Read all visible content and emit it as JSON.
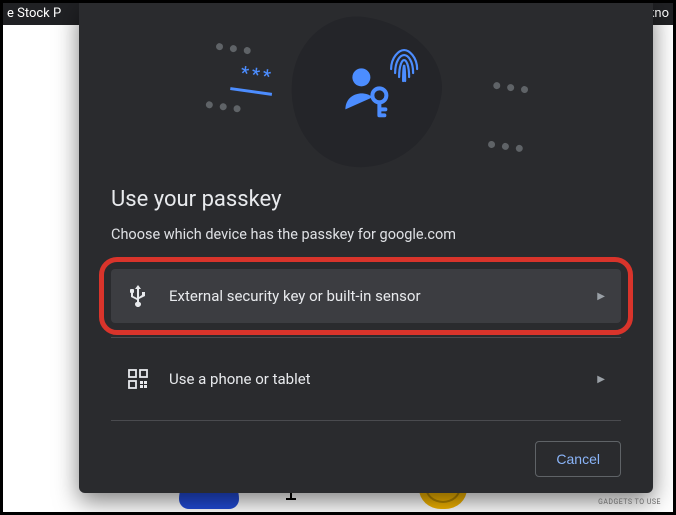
{
  "topbar": {
    "left_text": "e Stock P",
    "right_text": "ate a kno"
  },
  "dialog": {
    "title": "Use your passkey",
    "subtitle": "Choose which device has the passkey for google.com",
    "options": [
      {
        "label": "External security key or built-in sensor"
      },
      {
        "label": "Use a phone or tablet"
      }
    ],
    "cancel_label": "Cancel"
  },
  "watermark": "GADGETS TO USE"
}
